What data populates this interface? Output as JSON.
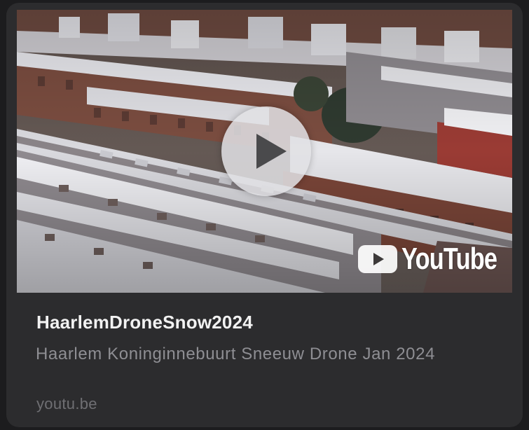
{
  "link_preview": {
    "thumbnail": {
      "alt": "Aerial drone view of snow-covered rowhouses",
      "play_button_icon": "play-icon",
      "watermark": "YouTube",
      "watermark_icon": "youtube-play-badge-icon"
    },
    "title": "HaarlemDroneSnow2024",
    "description": "Haarlem Koninginnebuurt Sneeuw Drone Jan 2024",
    "domain": "youtu.be"
  },
  "colors": {
    "card_background": "#2c2c2e",
    "title_text": "#f2f2f2",
    "description_text": "#8e8e93",
    "domain_text": "#6f6f73",
    "brick": "#7a4a3c",
    "snow": "#e6e6ea"
  }
}
